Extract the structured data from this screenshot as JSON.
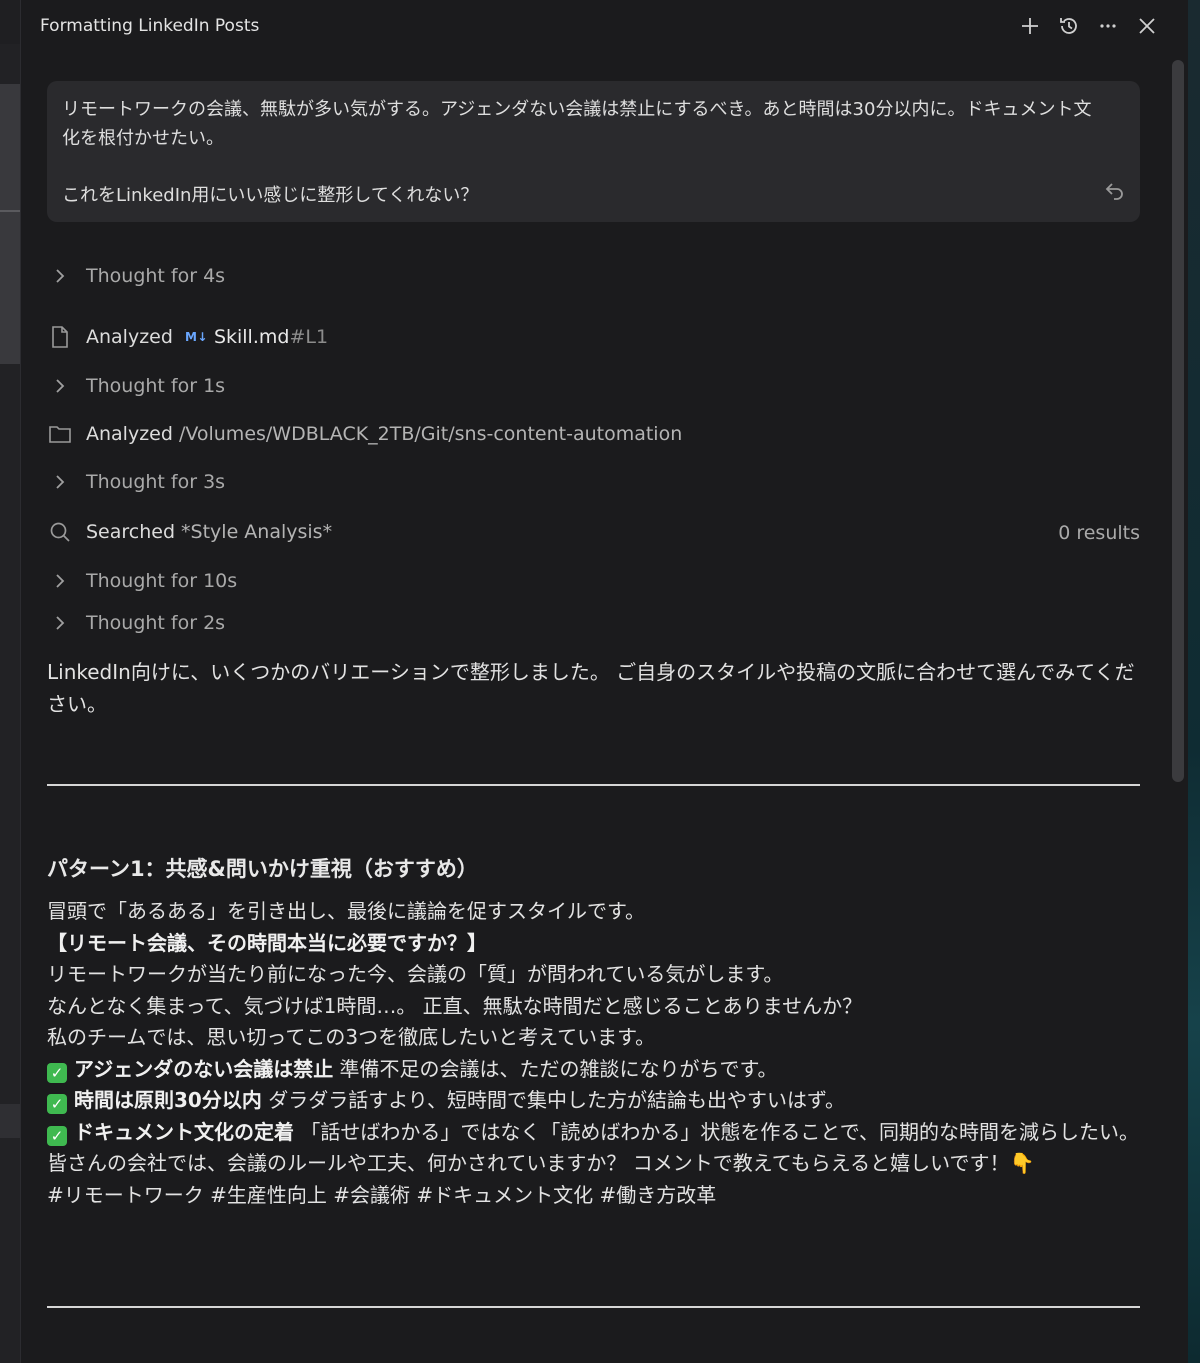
{
  "window": {
    "title": "Formatting LinkedIn Posts",
    "icons": [
      "plus-icon",
      "history-icon",
      "more-icon",
      "close-icon"
    ]
  },
  "user_message": {
    "line1": "リモートワークの会議、無駄が多い気がする。アジェンダない会議は禁止にするべき。あと時間は30分以内に。ドキュメント文化を根付かせたい。",
    "line2": "これをLinkedIn用にいい感じに整形してくれない？"
  },
  "steps": [
    {
      "type": "thought",
      "label": "Thought for 4s"
    },
    {
      "type": "analyzed-file",
      "verb": "Analyzed",
      "badge": "M↓",
      "file": "Skill.md",
      "anchor": "#L1"
    },
    {
      "type": "thought",
      "label": "Thought for 1s"
    },
    {
      "type": "analyzed-folder",
      "verb": "Analyzed",
      "path": "/Volumes/WDBLACK_2TB/Git/sns-content-automation"
    },
    {
      "type": "thought",
      "label": "Thought for 3s"
    },
    {
      "type": "searched",
      "verb": "Searched",
      "query": "*Style Analysis*",
      "results": "0 results"
    },
    {
      "type": "thought",
      "label": "Thought for 10s"
    },
    {
      "type": "thought",
      "label": "Thought for 2s"
    }
  ],
  "answer": {
    "intro": "LinkedIn向けに、いくつかのバリエーションで整形しました。 ご自身のスタイルや投稿の文脈に合わせて選んでみてください。",
    "pattern1": {
      "heading": "パターン1：共感&問いかけ重視（おすすめ）",
      "desc": "冒頭で「あるある」を引き出し、最後に議論を促すスタイルです。",
      "post_title": "【リモート会議、その時間本当に必要ですか？】",
      "l1": "リモートワークが当たり前になった今、会議の「質」が問われている気がします。",
      "l2": "なんとなく集まって、気づけば1時間…。 正直、無駄な時間だと感じることありませんか？",
      "l3": "私のチームでは、思い切ってこの3つを徹底したいと考えています。",
      "c1_bold": "アジェンダのない会議は禁止",
      "c1_text": " 準備不足の会議は、ただの雑談になりがちです。",
      "c2_bold": "時間は原則30分以内",
      "c2_text": " ダラダラ話すより、短時間で集中した方が結論も出やすいはず。",
      "c3_bold": "ドキュメント文化の定着",
      "c3_text": " 「話せばわかる」ではなく「読めばわかる」状態を作ることで、同期的な時間を減らしたい。",
      "closing": "皆さんの会社では、会議のルールや工夫、何かされていますか？ コメントで教えてもらえると嬉しいです！👇",
      "hashtags": "#リモートワーク #生産性向上 #会議術 #ドキュメント文化 #働き方改革"
    }
  }
}
